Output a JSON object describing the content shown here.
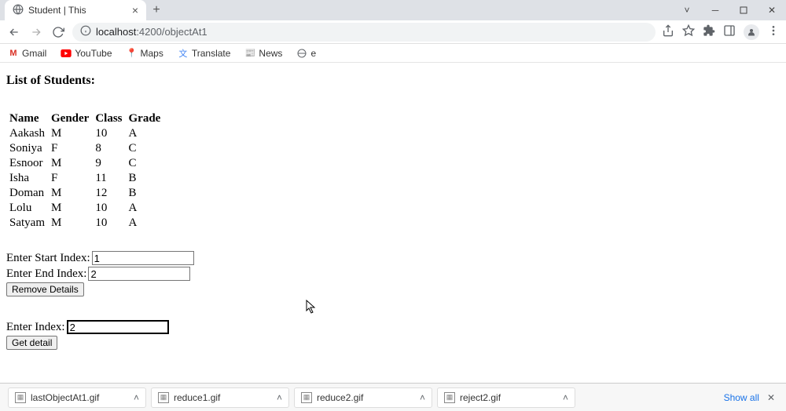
{
  "browser": {
    "tab_title": "Student | This",
    "url_display": "localhost:4200/objectAt1",
    "url_domain": "localhost",
    "url_rest": ":4200/objectAt1"
  },
  "bookmarks": [
    {
      "label": "Gmail"
    },
    {
      "label": "YouTube"
    },
    {
      "label": "Maps"
    },
    {
      "label": "Translate"
    },
    {
      "label": "News"
    },
    {
      "label": "e"
    }
  ],
  "page": {
    "heading": "List of Students:",
    "columns": [
      "Name",
      "Gender",
      "Class",
      "Grade"
    ],
    "students": [
      {
        "name": "Aakash",
        "gender": "M",
        "class": "10",
        "grade": "A"
      },
      {
        "name": "Soniya",
        "gender": "F",
        "class": "8",
        "grade": "C"
      },
      {
        "name": "Esnoor",
        "gender": "M",
        "class": "9",
        "grade": "C"
      },
      {
        "name": "Isha",
        "gender": "F",
        "class": "11",
        "grade": "B"
      },
      {
        "name": "Doman",
        "gender": "M",
        "class": "12",
        "grade": "B"
      },
      {
        "name": "Lolu",
        "gender": "M",
        "class": "10",
        "grade": "A"
      },
      {
        "name": "Satyam",
        "gender": "M",
        "class": "10",
        "grade": "A"
      }
    ],
    "form": {
      "start_label": "Enter Start Index:",
      "start_value": "1",
      "end_label": "Enter End Index:",
      "end_value": "2",
      "remove_button": "Remove Details",
      "index_label": "Enter Index:",
      "index_value": "2",
      "get_button": "Get detail"
    }
  },
  "downloads": {
    "items": [
      {
        "name": "lastObjectAt1.gif"
      },
      {
        "name": "reduce1.gif"
      },
      {
        "name": "reduce2.gif"
      },
      {
        "name": "reject2.gif"
      }
    ],
    "show_all": "Show all"
  }
}
